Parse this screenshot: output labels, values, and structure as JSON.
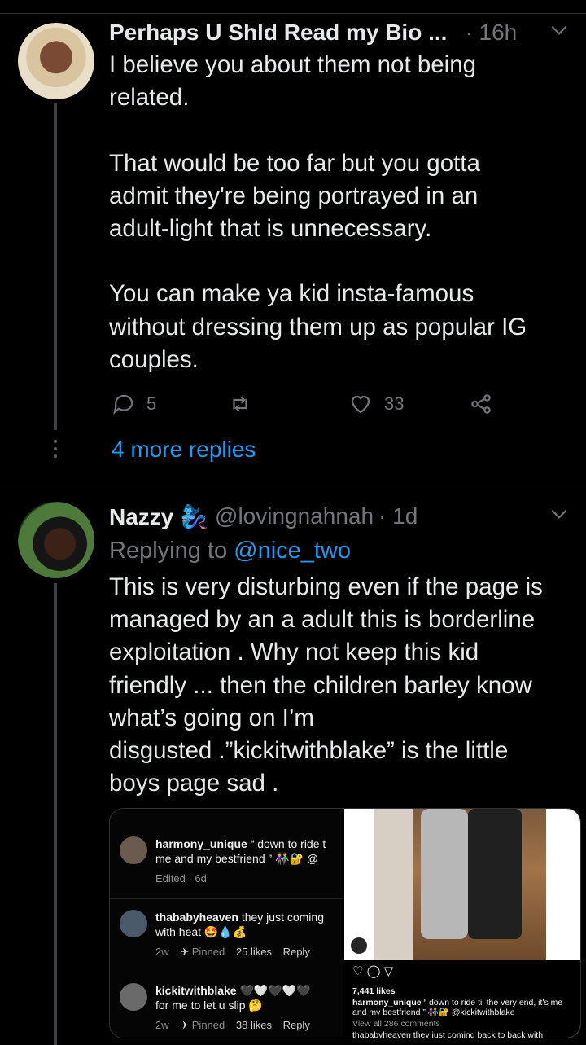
{
  "tweets": [
    {
      "name": "Perhaps U Shld Read my Bio ...",
      "handle": "",
      "time": "· 16h",
      "text": "I believe you about them not being\nrelated.\n\nThat would be too far but you gotta\nadmit they're being portrayed in an\nadult-light that is unnecessary.\n\nYou can make ya kid insta-famous\nwithout dressing them up as popular IG\ncouples.",
      "replies": "5",
      "retweets": "",
      "likes": "33",
      "more_replies": "4 more replies"
    },
    {
      "name": "Nazzy 🧞‍♀️",
      "handle": "@lovingnahnah",
      "time": "· 1d",
      "replying_label": "Replying to",
      "replying_handle": "@nice_two",
      "text": "This is very disturbing even if the page is\nmanaged by an a adult this is borderline\nexploitation . Why not keep this kid\nfriendly ... then the children barley know\nwhat’s going on I’m\ndisgusted .”kickitwithblake” is the little\nboys page sad ."
    }
  ],
  "embedded": {
    "comments": [
      {
        "user": "harmony_unique",
        "text": "“ down to ride t",
        "line2": "me and my bestfriend ” 👫🔐 @",
        "meta": "Edited · 6d"
      },
      {
        "user": "thababyheaven",
        "text": "they just coming",
        "line2": "with heat 🤩💧💰",
        "meta_time": "2w",
        "pinned": "Pinned",
        "likes": "25 likes",
        "reply": "Reply"
      },
      {
        "user": "kickitwithblake",
        "text": "🖤🤍🖤🤍🖤",
        "line2": "for me to  let u slip 🤔",
        "meta_time": "2w",
        "pinned": "Pinned",
        "likes": "38 likes",
        "reply": "Reply"
      }
    ],
    "insta": {
      "likes": "7,441 likes",
      "caption_user": "harmony_unique",
      "caption": "“ down to ride til the very end, it's me and my bestfriend ” 👫🔐 @kickitwithblake",
      "view_all": "View all 286 comments",
      "next": "thababyheaven they just coming back to back with"
    }
  },
  "colors": {
    "accent": "#1d9bf0",
    "muted": "#71767b",
    "background": "#000000"
  }
}
